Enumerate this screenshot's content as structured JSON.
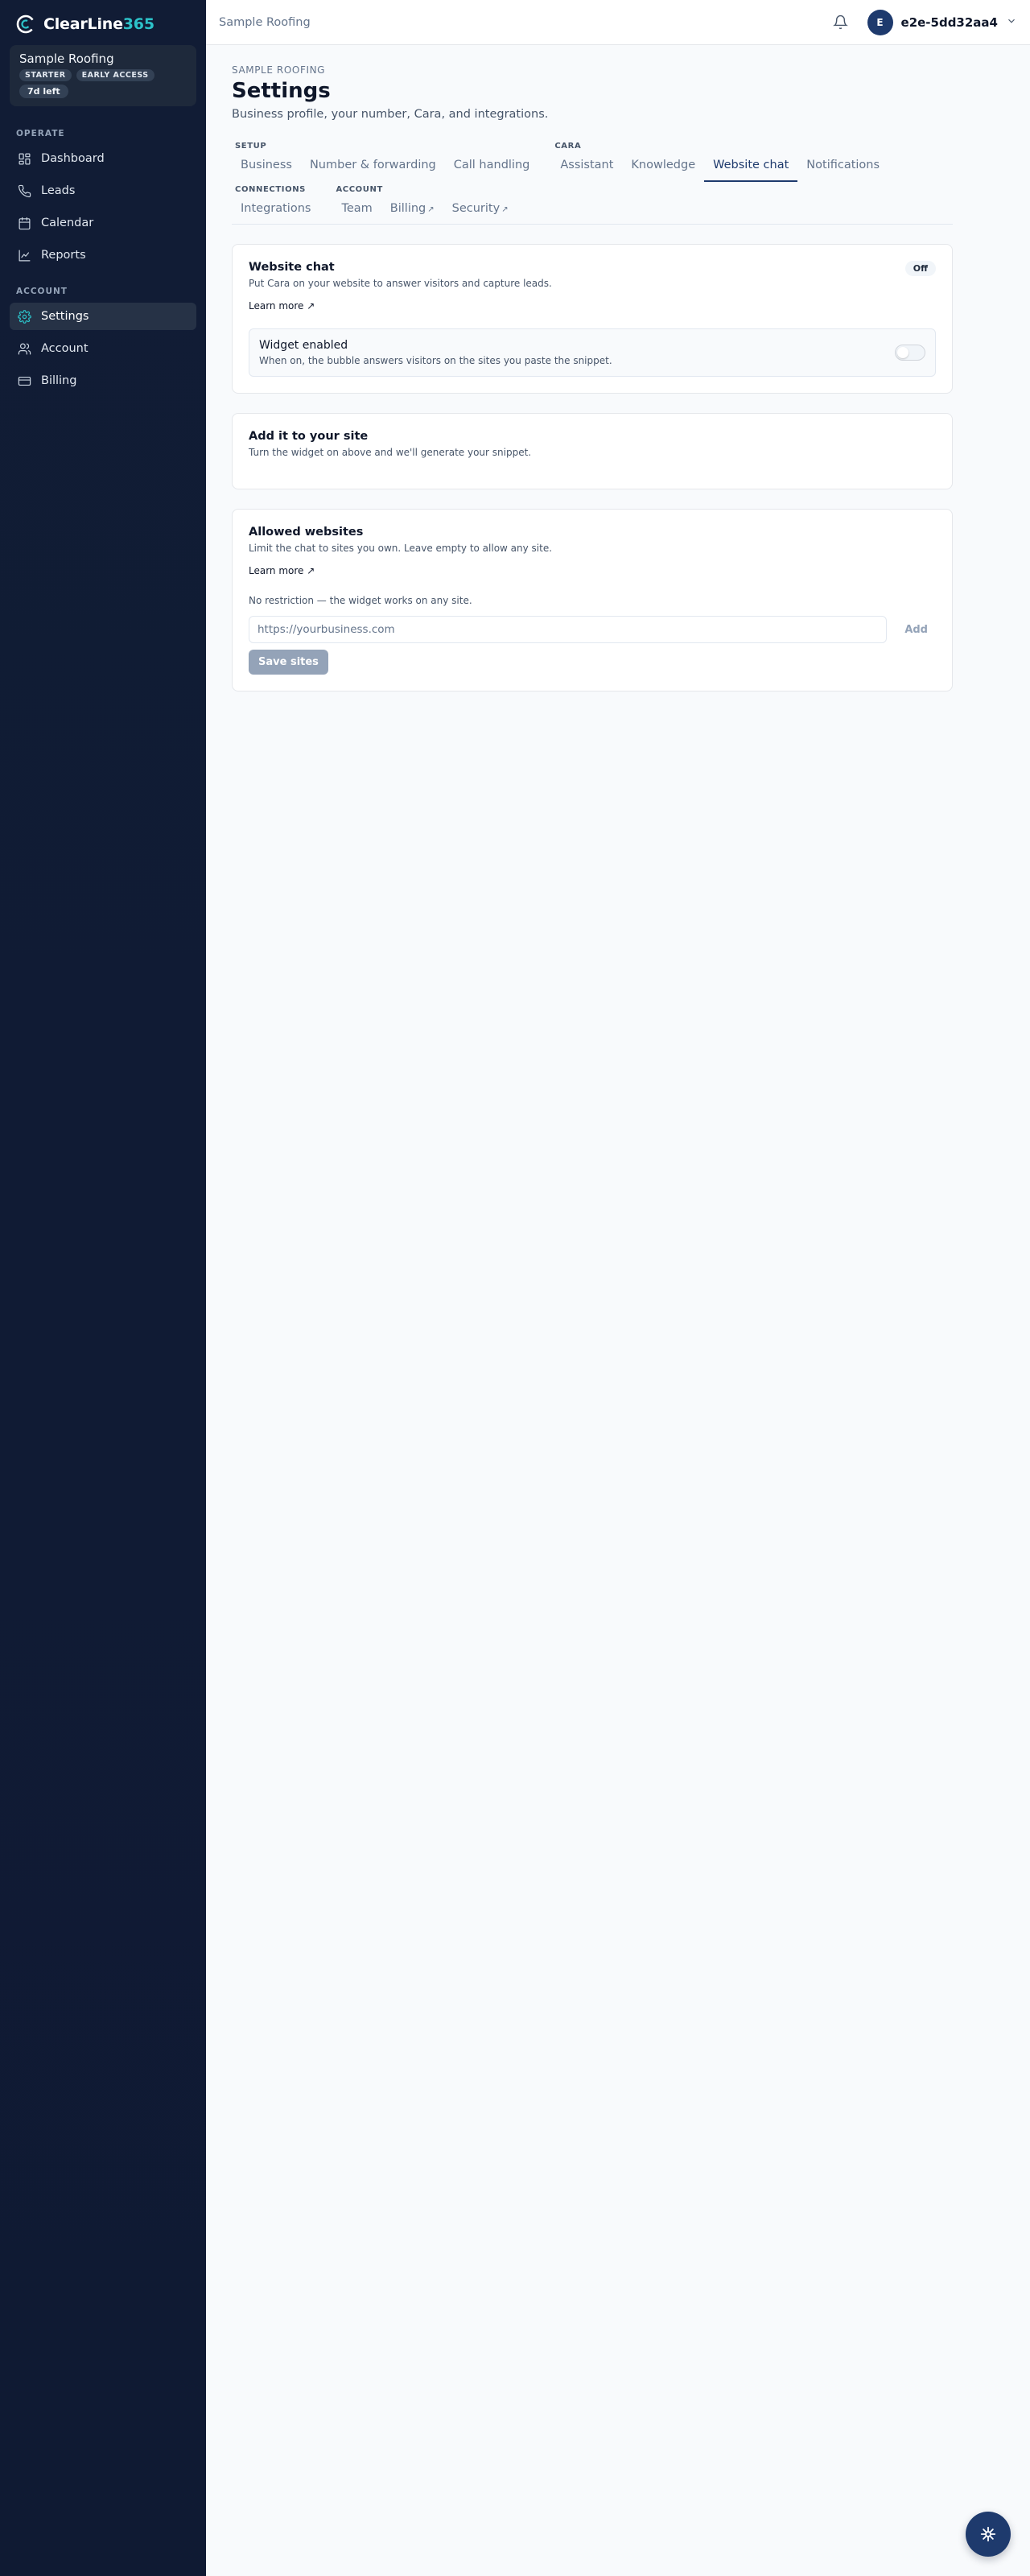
{
  "brand": {
    "name": "ClearLine",
    "suffix": "365"
  },
  "org": {
    "name": "Sample Roofing",
    "plan_badge": "STARTER",
    "access_badge": "EARLY ACCESS",
    "trial": "7d left"
  },
  "nav": {
    "operate_heading": "OPERATE",
    "operate": [
      {
        "label": "Dashboard",
        "icon": "dashboard-icon"
      },
      {
        "label": "Leads",
        "icon": "phone-icon"
      },
      {
        "label": "Calendar",
        "icon": "calendar-icon"
      },
      {
        "label": "Reports",
        "icon": "chart-icon"
      }
    ],
    "account_heading": "ACCOUNT",
    "account": [
      {
        "label": "Settings",
        "icon": "gear-icon",
        "active": true
      },
      {
        "label": "Account",
        "icon": "user-icon"
      },
      {
        "label": "Billing",
        "icon": "credit-card-icon"
      }
    ]
  },
  "topbar": {
    "breadcrumb": "Sample Roofing",
    "avatar_initial": "E",
    "username": "e2e-5dd32aa4"
  },
  "page": {
    "eyebrow": "SAMPLE ROOFING",
    "title": "Settings",
    "subtitle": "Business profile, your number, Cara, and integrations."
  },
  "tabs": {
    "setup_label": "SETUP",
    "setup": [
      "Business",
      "Number & forwarding",
      "Call handling"
    ],
    "cara_label": "CARA",
    "cara": [
      "Assistant",
      "Knowledge",
      "Website chat",
      "Notifications"
    ],
    "connections_label": "CONNECTIONS",
    "connections": [
      "Integrations"
    ],
    "account_label": "ACCOUNT",
    "account": [
      "Team",
      "Billing",
      "Security"
    ],
    "external_mark": "↗",
    "active": "Website chat"
  },
  "website_chat": {
    "title": "Website chat",
    "desc": "Put Cara on your website to answer visitors and capture leads.",
    "learn_more": "Learn more",
    "status": "Off",
    "widget_title": "Widget enabled",
    "widget_desc": "When on, the bubble answers visitors on the sites you paste the snippet.",
    "widget_enabled": false
  },
  "add_to_site": {
    "title": "Add it to your site",
    "desc": "Turn the widget on above and we'll generate your snippet."
  },
  "allowed_sites": {
    "title": "Allowed websites",
    "desc": "Limit the chat to sites you own. Leave empty to allow any site.",
    "learn_more": "Learn more",
    "no_restriction": "No restriction — the widget works on any site.",
    "input_placeholder": "https://yourbusiness.com",
    "input_value": "",
    "add_label": "Add",
    "save_label": "Save sites"
  },
  "colors": {
    "accent": "#1e3a6d",
    "brand_teal": "#2cc2c9",
    "sidebar_bg": "#111c35"
  }
}
